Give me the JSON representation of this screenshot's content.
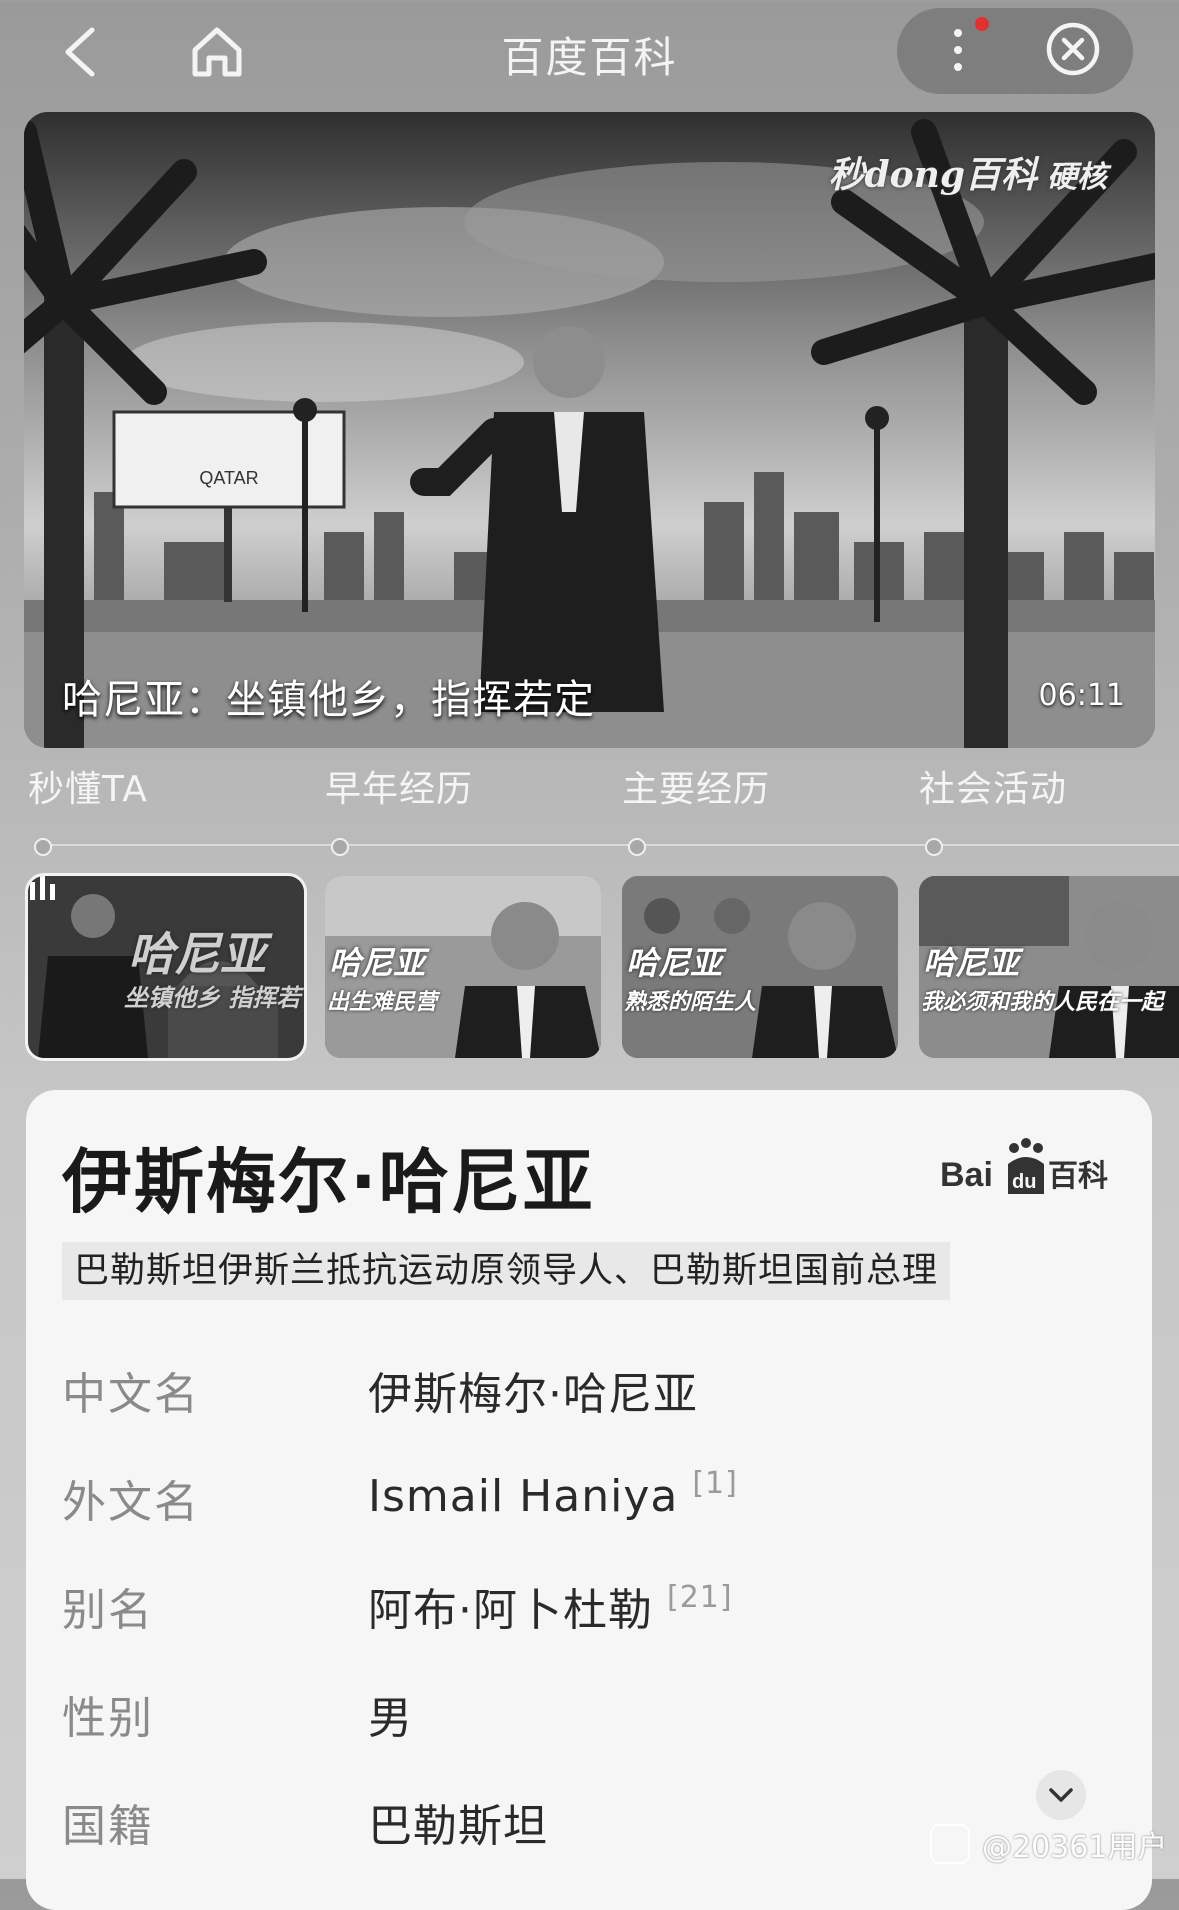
{
  "header": {
    "title": "百度百科",
    "back_icon": "chevron-left-icon",
    "home_icon": "home-icon",
    "more_icon": "more-vertical-icon",
    "close_icon": "close-circle-icon"
  },
  "video": {
    "watermark": "秒dong百科",
    "watermark_tag": "硬核",
    "billboard_text": "QATAR",
    "subtitle": "哈尼亚：坐镇他乡，指挥若定",
    "duration": "06:11"
  },
  "chapters": [
    {
      "label": "秒懂TA"
    },
    {
      "label": "早年经历"
    },
    {
      "label": "主要经历"
    },
    {
      "label": "社会活动"
    }
  ],
  "thumbnails": [
    {
      "title": "哈尼亚",
      "subtitle": "坐镇他乡 指挥若",
      "active": true
    },
    {
      "title": "哈尼亚",
      "subtitle": "出生难民营",
      "active": false
    },
    {
      "title": "哈尼亚",
      "subtitle": "熟悉的陌生人",
      "active": false
    },
    {
      "title": "哈尼亚",
      "subtitle": "我必须和我的人民在一起",
      "active": false
    }
  ],
  "card": {
    "name": "伊斯梅尔·哈尼亚",
    "logo_text": "Bai",
    "logo_du": "du",
    "logo_suffix": "百科",
    "description": "巴勒斯坦伊斯兰抵抗运动原领导人、巴勒斯坦国前总理",
    "rows": [
      {
        "key": "中文名",
        "value": "伊斯梅尔·哈尼亚",
        "ref": ""
      },
      {
        "key": "外文名",
        "value": "Ismail Haniya",
        "ref": "[1]"
      },
      {
        "key": "别名",
        "value": "阿布·阿卜杜勒",
        "ref": "[21]"
      },
      {
        "key": "性别",
        "value": "男",
        "ref": ""
      },
      {
        "key": "国籍",
        "value": "巴勒斯坦",
        "ref": ""
      }
    ],
    "expand_icon": "chevron-down-icon"
  },
  "footer_watermark": "@20361用户"
}
